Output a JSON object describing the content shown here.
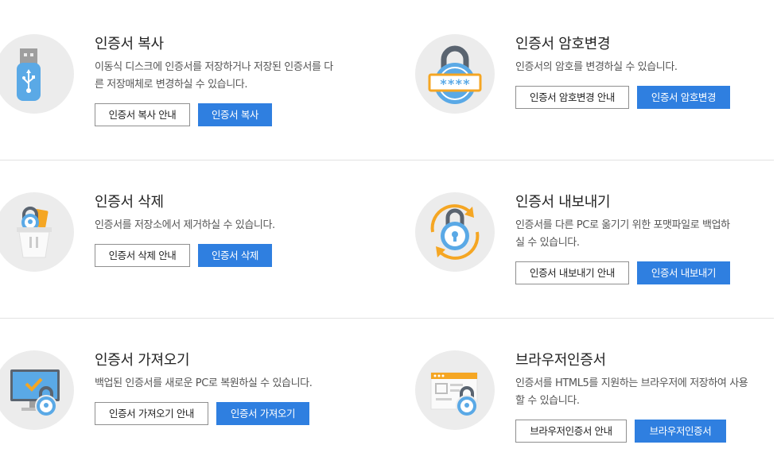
{
  "cards": {
    "copy": {
      "title": "인증서 복사",
      "desc": "이동식 디스크에 인증서를 저장하거나 저장된 인증서를 다른 저장매체로 변경하실 수 있습니다.",
      "guide_label": "인증서 복사 안내",
      "action_label": "인증서 복사",
      "icon": "usb-icon"
    },
    "password": {
      "title": "인증서 암호변경",
      "desc": "인증서의 암호를 변경하실 수 있습니다.",
      "guide_label": "인증서 암호변경 안내",
      "action_label": "인증서 암호변경",
      "mask": "****",
      "icon": "lock-password-icon"
    },
    "delete": {
      "title": "인증서 삭제",
      "desc": "인증서를 저장소에서 제거하실 수 있습니다.",
      "guide_label": "인증서 삭제 안내",
      "action_label": "인증서 삭제",
      "icon": "trash-lock-icon"
    },
    "export": {
      "title": "인증서 내보내기",
      "desc": "인증서를 다른 PC로 옮기기 위한 포맷파일로 백업하실 수 있습니다.",
      "guide_label": "인증서 내보내기 안내",
      "action_label": "인증서 내보내기",
      "icon": "lock-sync-icon"
    },
    "import": {
      "title": "인증서 가져오기",
      "desc": "백업된 인증서를 새로운 PC로 복원하실 수 있습니다.",
      "guide_label": "인증서 가져오기 안내",
      "action_label": "인증서 가져오기",
      "icon": "monitor-lock-icon"
    },
    "browser": {
      "title": "브라우저인증서",
      "desc": "인증서를 HTML5를 지원하는 브라우저에 저장하여 사용할 수 있습니다.",
      "guide_label": "브라우저인증서 안내",
      "action_label": "브라우저인증서",
      "icon": "browser-lock-icon"
    }
  },
  "colors": {
    "primary": "#2f7fe0",
    "icon_blue": "#5aa9e6",
    "icon_orange": "#f5a623",
    "circle_bg": "#ececec"
  }
}
